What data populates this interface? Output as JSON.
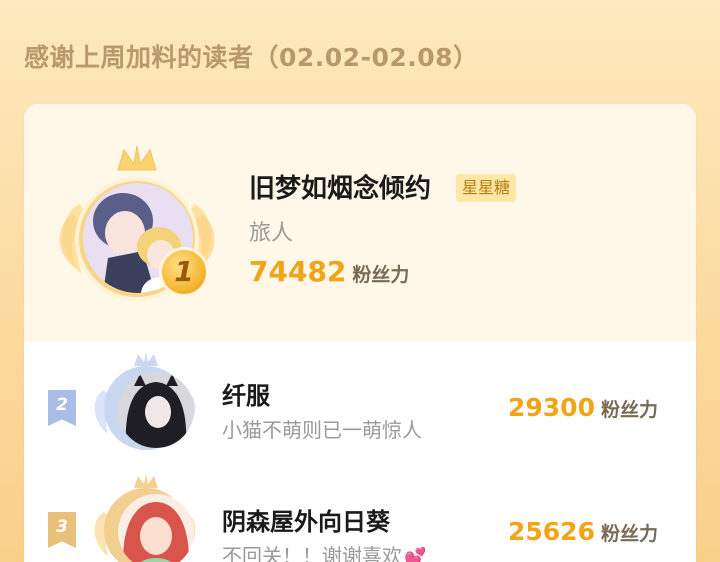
{
  "header": {
    "title": "感谢上周加料的读者（02.02-02.08）"
  },
  "first": {
    "rank": "1",
    "name": "旧梦如烟念倾约",
    "tag": "星星糖",
    "subtitle": "旅人",
    "score": "74482",
    "unit": "粉丝力"
  },
  "rows": [
    {
      "rank": "2",
      "name": "纤服",
      "subtitle": "小猫不萌则已一萌惊人",
      "score": "29300",
      "unit": "粉丝力"
    },
    {
      "rank": "3",
      "name": "阴森屋外向日葵",
      "subtitle": "不回关！！谢谢喜欢",
      "score": "25626",
      "unit": "粉丝力"
    }
  ],
  "colors": {
    "accent": "#f2a418",
    "rank2": "#a9bde6",
    "rank3": "#e8c07a"
  },
  "icons": [
    "crown-icon",
    "wing-icon",
    "heart-icon"
  ]
}
